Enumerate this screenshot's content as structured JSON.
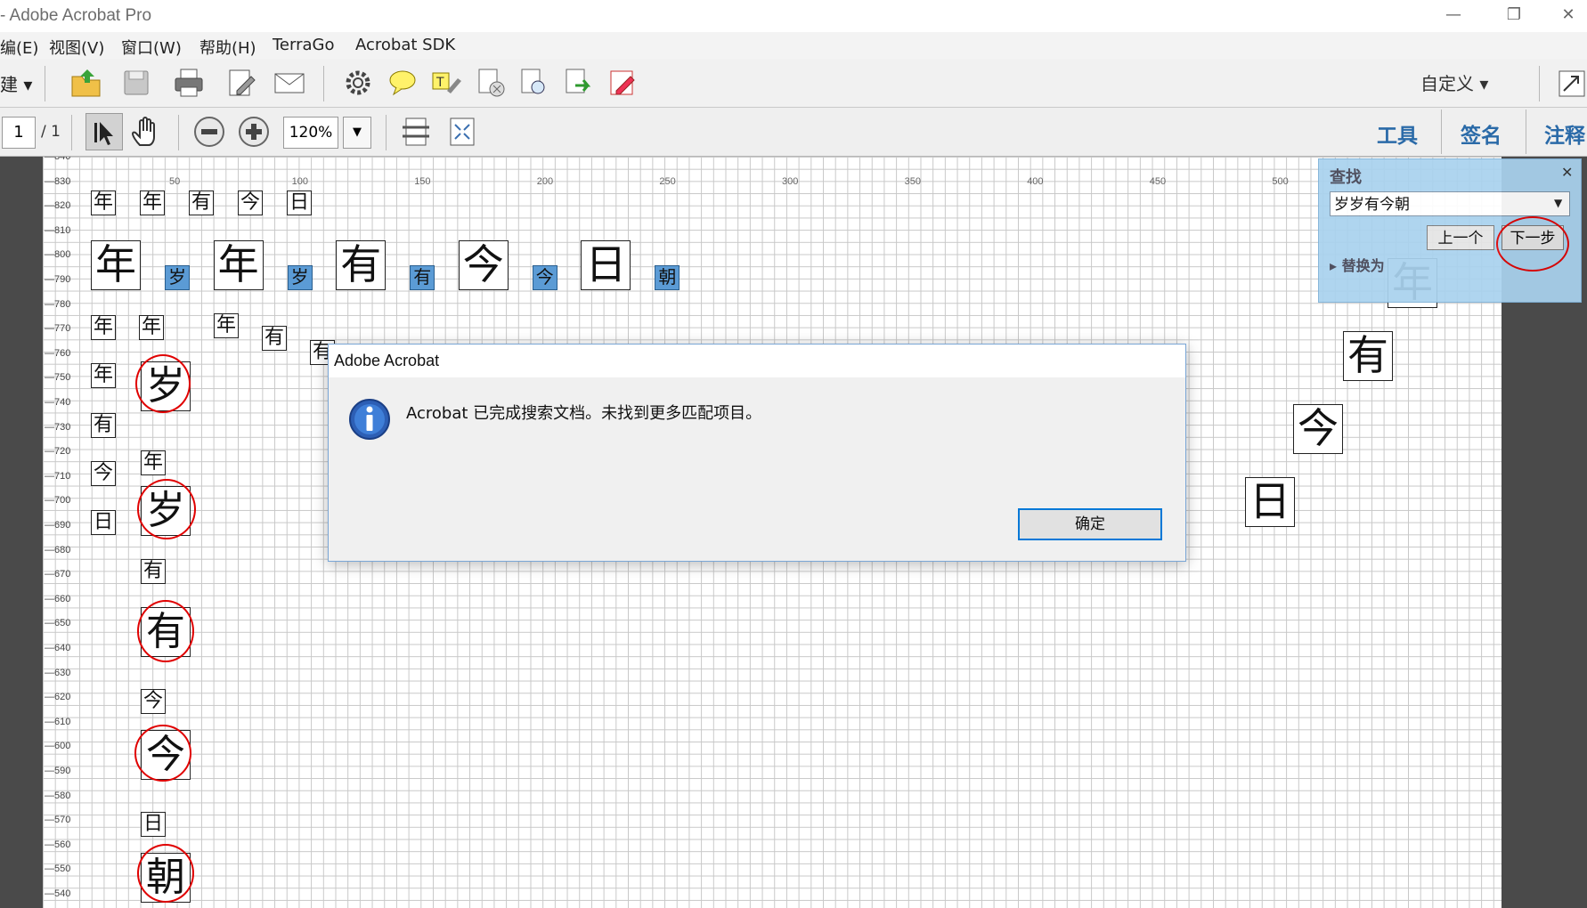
{
  "window": {
    "title": "- Adobe Acrobat Pro"
  },
  "menubar": {
    "items": [
      "编(E)",
      "视图(V)",
      "窗口(W)",
      "帮助(H)",
      "TerraGo",
      "Acrobat SDK"
    ]
  },
  "toolbar": {
    "create_label": "建",
    "customize_label": "自定义",
    "page_number": "1",
    "page_total": "/ 1",
    "zoom": "120%",
    "tabs": [
      "工具",
      "签名",
      "注释"
    ]
  },
  "ruler": {
    "left": [
      "840",
      "830",
      "820",
      "810",
      "800",
      "790",
      "780",
      "770",
      "760",
      "750",
      "740",
      "730",
      "720",
      "710",
      "700",
      "690",
      "680",
      "670",
      "660",
      "650",
      "640",
      "630",
      "620",
      "610",
      "600",
      "590",
      "580",
      "570",
      "560",
      "550",
      "540"
    ],
    "top": [
      "50",
      "100",
      "150",
      "200",
      "250",
      "300",
      "350",
      "400",
      "450",
      "500"
    ]
  },
  "page": {
    "row1": [
      "年",
      "年",
      "有",
      "今",
      "日"
    ],
    "row2_big": [
      "年",
      "年",
      "有",
      "今",
      "日"
    ],
    "row2_small": [
      "岁",
      "岁",
      "有",
      "今",
      "朝"
    ],
    "col_a": [
      "年",
      "年",
      "有",
      "今",
      "日"
    ],
    "col_b": [
      "年",
      "岁",
      "年",
      "岁",
      "有",
      "有",
      "今",
      "今",
      "日",
      "朝"
    ],
    "row3_extra": [
      "年",
      "年",
      "有"
    ],
    "diag": [
      "年",
      "有",
      "今",
      "日"
    ]
  },
  "find_panel": {
    "title": "查找",
    "query": "岁岁有今朝",
    "prev_label": "上一个",
    "next_label": "下一步",
    "replace_label": "替换为"
  },
  "dialog": {
    "title": "Adobe Acrobat",
    "message": "Acrobat 已完成搜索文档。未找到更多匹配项目。",
    "ok_label": "确定"
  },
  "colors": {
    "accent": "#0078d7",
    "highlight": "#5b9bd5",
    "annotation_red": "#e00000",
    "find_panel": "#a9d2ee"
  }
}
